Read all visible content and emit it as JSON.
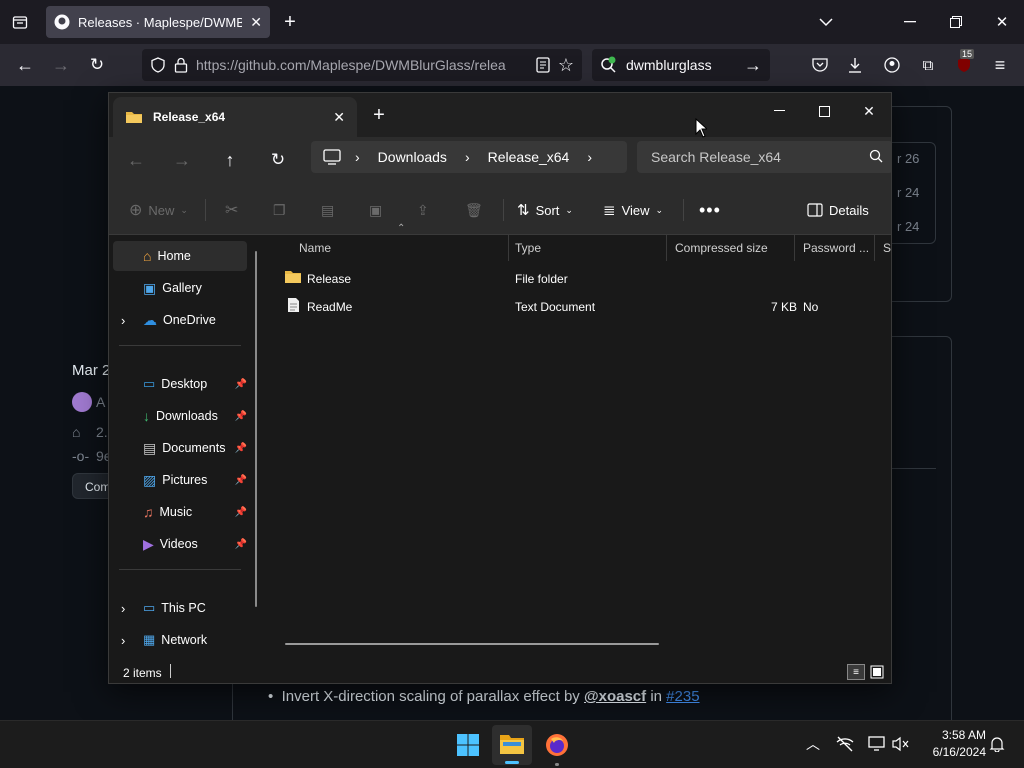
{
  "browser": {
    "tab_title": "Releases · Maplespe/DWMBlurGlass",
    "url": "https://github.com/Maplespe/DWMBlurGlass/relea",
    "search_text": "dwmblurglass",
    "badge_count": "15"
  },
  "github_bg": {
    "dates": [
      "r 26",
      "r 24",
      "r 24"
    ],
    "left_date": "Mar 2",
    "left_line1": "A",
    "left_line2": "2.",
    "left_line3": "9e",
    "left_button": "Com",
    "bullet_text": "Invert X-direction scaling of parallax effect by",
    "bullet_user": "@xoascf",
    "bullet_in": "in",
    "bullet_link": "#235"
  },
  "explorer": {
    "tab_title": "Release_x64",
    "breadcrumb": [
      "Downloads",
      "Release_x64"
    ],
    "search_placeholder": "Search Release_x64",
    "commands": {
      "new": "New",
      "sort": "Sort",
      "view": "View",
      "details": "Details"
    },
    "nav": {
      "home": "Home",
      "gallery": "Gallery",
      "onedrive": "OneDrive",
      "desktop": "Desktop",
      "downloads": "Downloads",
      "documents": "Documents",
      "pictures": "Pictures",
      "music": "Music",
      "videos": "Videos",
      "thispc": "This PC",
      "network": "Network"
    },
    "columns": {
      "name": "Name",
      "type": "Type",
      "compressed": "Compressed size",
      "password": "Password ...",
      "size": "Si"
    },
    "files": [
      {
        "name": "Release",
        "type": "File folder",
        "size": "",
        "password": ""
      },
      {
        "name": "ReadMe",
        "type": "Text Document",
        "size": "7 KB",
        "password": "No"
      }
    ],
    "status": "2 items"
  },
  "taskbar": {
    "time": "3:58 AM",
    "date": "6/16/2024"
  }
}
